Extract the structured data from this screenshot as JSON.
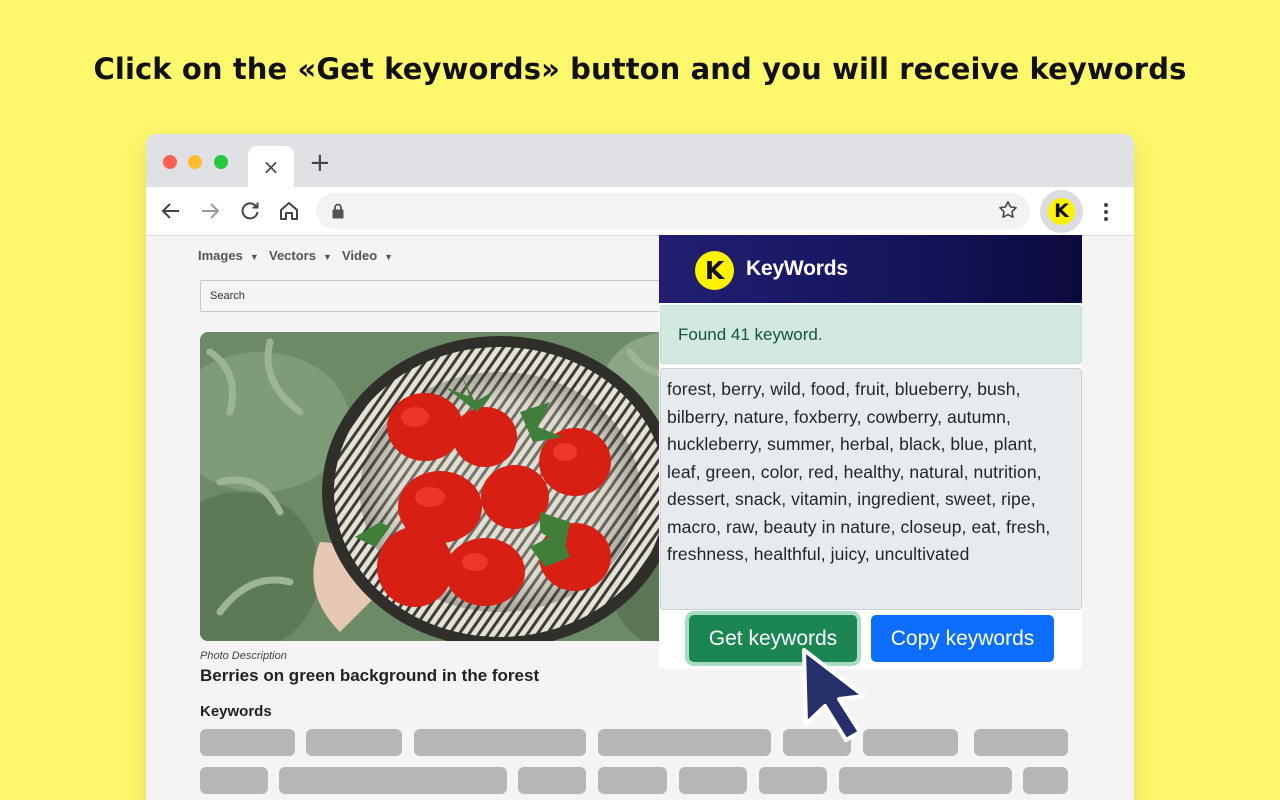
{
  "headline": "Click on the «Get keywords» button and you will receive keywords",
  "browser": {
    "tab_close_glyph": "×",
    "new_tab_glyph": "+",
    "icons": [
      "back-arrow-icon",
      "forward-arrow-icon",
      "reload-icon",
      "home-icon",
      "lock-icon",
      "bookmark-star-icon",
      "extension-icon",
      "kebab-menu-icon"
    ],
    "extension_letter": "K"
  },
  "site": {
    "menu": [
      "Images",
      "Vectors",
      "Video"
    ],
    "search_placeholder": "Search",
    "photo_caption": "Photo Description",
    "photo_title": "Berries on green background in the forest",
    "keywords_heading": "Keywords"
  },
  "popup": {
    "logo_letter": "K",
    "brand": "KeyWords",
    "status": "Found 41 keyword.",
    "keywords_text": "forest, berry, wild, food, fruit, blueberry, bush, bilberry, nature, foxberry, cowberry, autumn, huckleberry, summer, herbal, black, blue, plant, leaf, green, color, red, healthy, natural, nutrition, dessert, snack, vitamin, ingredient, sweet, ripe, macro, raw, beauty in nature, closeup, eat, fresh, freshness, healthful, juicy, uncultivated",
    "get_button": "Get keywords",
    "copy_button": "Copy keywords"
  },
  "colors": {
    "background": "#fef86c",
    "header_gradient": "#221f72",
    "alert_bg": "#d3e9e0",
    "get_button": "#1c8653",
    "copy_button": "#0d6efd",
    "cursor": "#25306a"
  }
}
